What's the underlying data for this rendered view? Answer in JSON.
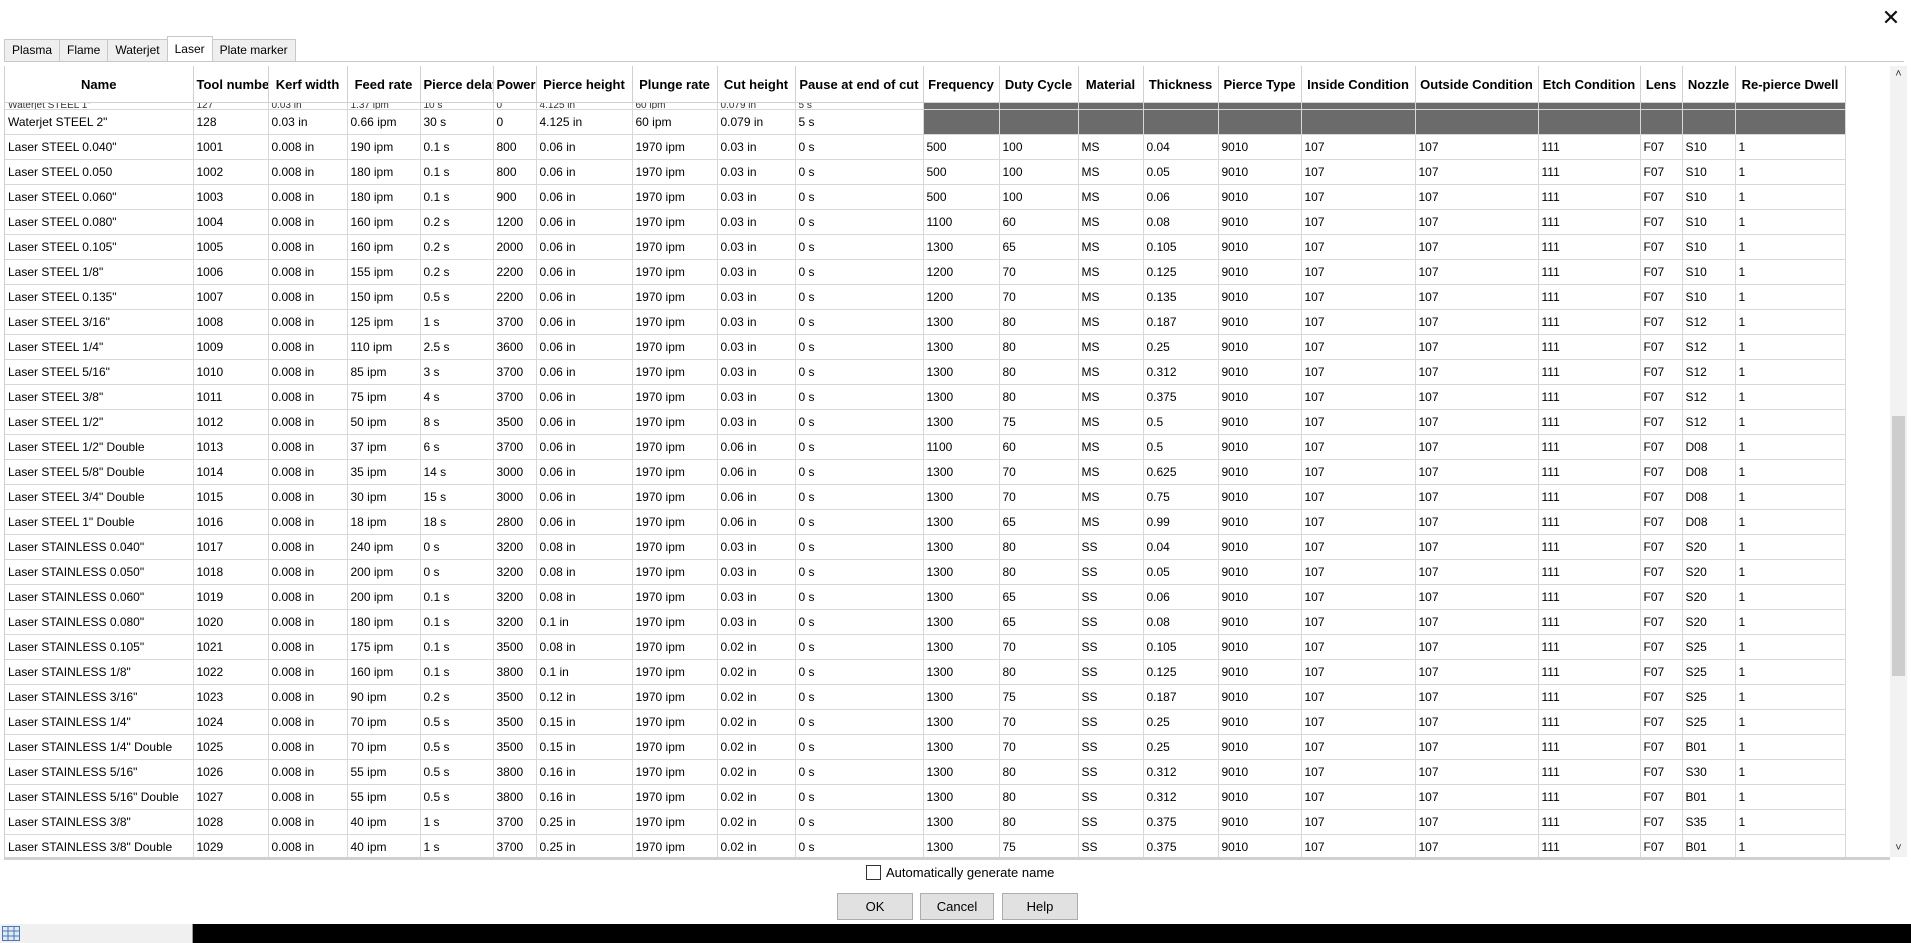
{
  "tabs": [
    "Plasma",
    "Flame",
    "Waterjet",
    "Laser",
    "Plate marker"
  ],
  "active_tab": "Laser",
  "columns": [
    "Name",
    "Tool number",
    "Kerf width",
    "Feed rate",
    "Pierce delay",
    "Power",
    "Pierce height",
    "Plunge rate",
    "Cut height",
    "Pause at end of cut",
    "Frequency",
    "Duty Cycle",
    "Material",
    "Thickness",
    "Pierce Type",
    "Inside Condition",
    "Outside Condition",
    "Etch Condition",
    "Lens",
    "Nozzle",
    "Re-pierce Dwell"
  ],
  "partial_top_row": [
    "Waterjet STEEL 1\"",
    "127",
    "0.03 in",
    "1.37 ipm",
    "10 s",
    "0",
    "4.125 in",
    "60 ipm",
    "0.079 in",
    "5 s",
    "",
    "",
    "",
    "",
    "",
    "",
    "",
    "",
    "",
    "",
    ""
  ],
  "rows": [
    [
      "Waterjet STEEL 2\"",
      "128",
      "0.03 in",
      "0.66 ipm",
      "30 s",
      "0",
      "4.125 in",
      "60 ipm",
      "0.079 in",
      "5 s",
      "",
      "",
      "",
      "",
      "",
      "",
      "",
      "",
      "",
      "",
      ""
    ],
    [
      "Laser STEEL 0.040\"",
      "1001",
      "0.008 in",
      "190 ipm",
      "0.1 s",
      "800",
      "0.06 in",
      "1970 ipm",
      "0.03 in",
      "0 s",
      "500",
      "100",
      "MS",
      "0.04",
      "9010",
      "107",
      "107",
      "111",
      "F07",
      "S10",
      "1"
    ],
    [
      "Laser STEEL 0.050",
      "1002",
      "0.008 in",
      "180 ipm",
      "0.1 s",
      "800",
      "0.06 in",
      "1970 ipm",
      "0.03 in",
      "0 s",
      "500",
      "100",
      "MS",
      "0.05",
      "9010",
      "107",
      "107",
      "111",
      "F07",
      "S10",
      "1"
    ],
    [
      "Laser STEEL 0.060\"",
      "1003",
      "0.008 in",
      "180 ipm",
      "0.1 s",
      "900",
      "0.06 in",
      "1970 ipm",
      "0.03 in",
      "0 s",
      "500",
      "100",
      "MS",
      "0.06",
      "9010",
      "107",
      "107",
      "111",
      "F07",
      "S10",
      "1"
    ],
    [
      "Laser STEEL 0.080\"",
      "1004",
      "0.008 in",
      "160 ipm",
      "0.2 s",
      "1200",
      "0.06 in",
      "1970 ipm",
      "0.03 in",
      "0 s",
      "1100",
      "60",
      "MS",
      "0.08",
      "9010",
      "107",
      "107",
      "111",
      "F07",
      "S10",
      "1"
    ],
    [
      "Laser STEEL 0.105\"",
      "1005",
      "0.008 in",
      "160 ipm",
      "0.2 s",
      "2000",
      "0.06 in",
      "1970 ipm",
      "0.03 in",
      "0 s",
      "1300",
      "65",
      "MS",
      "0.105",
      "9010",
      "107",
      "107",
      "111",
      "F07",
      "S10",
      "1"
    ],
    [
      "Laser STEEL 1/8\"",
      "1006",
      "0.008 in",
      "155 ipm",
      "0.2 s",
      "2200",
      "0.06 in",
      "1970 ipm",
      "0.03 in",
      "0 s",
      "1200",
      "70",
      "MS",
      "0.125",
      "9010",
      "107",
      "107",
      "111",
      "F07",
      "S10",
      "1"
    ],
    [
      "Laser STEEL 0.135\"",
      "1007",
      "0.008 in",
      "150 ipm",
      "0.5 s",
      "2200",
      "0.06 in",
      "1970 ipm",
      "0.03 in",
      "0 s",
      "1200",
      "70",
      "MS",
      "0.135",
      "9010",
      "107",
      "107",
      "111",
      "F07",
      "S10",
      "1"
    ],
    [
      "Laser STEEL 3/16\"",
      "1008",
      "0.008 in",
      "125 ipm",
      "1 s",
      "3700",
      "0.06 in",
      "1970 ipm",
      "0.03 in",
      "0 s",
      "1300",
      "80",
      "MS",
      "0.187",
      "9010",
      "107",
      "107",
      "111",
      "F07",
      "S12",
      "1"
    ],
    [
      "Laser STEEL 1/4\"",
      "1009",
      "0.008 in",
      "110 ipm",
      "2.5 s",
      "3600",
      "0.06 in",
      "1970 ipm",
      "0.03 in",
      "0 s",
      "1300",
      "80",
      "MS",
      "0.25",
      "9010",
      "107",
      "107",
      "111",
      "F07",
      "S12",
      "1"
    ],
    [
      "Laser STEEL 5/16\"",
      "1010",
      "0.008 in",
      "85 ipm",
      "3 s",
      "3700",
      "0.06 in",
      "1970 ipm",
      "0.03 in",
      "0 s",
      "1300",
      "80",
      "MS",
      "0.312",
      "9010",
      "107",
      "107",
      "111",
      "F07",
      "S12",
      "1"
    ],
    [
      "Laser STEEL 3/8\"",
      "1011",
      "0.008 in",
      "75 ipm",
      "4 s",
      "3700",
      "0.06 in",
      "1970 ipm",
      "0.03 in",
      "0 s",
      "1300",
      "80",
      "MS",
      "0.375",
      "9010",
      "107",
      "107",
      "111",
      "F07",
      "S12",
      "1"
    ],
    [
      "Laser STEEL 1/2\"",
      "1012",
      "0.008 in",
      "50 ipm",
      "8 s",
      "3500",
      "0.06 in",
      "1970 ipm",
      "0.03 in",
      "0 s",
      "1300",
      "75",
      "MS",
      "0.5",
      "9010",
      "107",
      "107",
      "111",
      "F07",
      "S12",
      "1"
    ],
    [
      "Laser STEEL 1/2\" Double",
      "1013",
      "0.008 in",
      "37 ipm",
      "6 s",
      "3700",
      "0.06 in",
      "1970 ipm",
      "0.06 in",
      "0 s",
      "1100",
      "60",
      "MS",
      "0.5",
      "9010",
      "107",
      "107",
      "111",
      "F07",
      "D08",
      "1"
    ],
    [
      "Laser STEEL 5/8\" Double",
      "1014",
      "0.008 in",
      "35 ipm",
      "14 s",
      "3000",
      "0.06 in",
      "1970 ipm",
      "0.06 in",
      "0 s",
      "1300",
      "70",
      "MS",
      "0.625",
      "9010",
      "107",
      "107",
      "111",
      "F07",
      "D08",
      "1"
    ],
    [
      "Laser STEEL 3/4\" Double",
      "1015",
      "0.008 in",
      "30 ipm",
      "15 s",
      "3000",
      "0.06 in",
      "1970 ipm",
      "0.06 in",
      "0 s",
      "1300",
      "70",
      "MS",
      "0.75",
      "9010",
      "107",
      "107",
      "111",
      "F07",
      "D08",
      "1"
    ],
    [
      "Laser STEEL 1\" Double",
      "1016",
      "0.008 in",
      "18 ipm",
      "18 s",
      "2800",
      "0.06 in",
      "1970 ipm",
      "0.06 in",
      "0 s",
      "1300",
      "65",
      "MS",
      "0.99",
      "9010",
      "107",
      "107",
      "111",
      "F07",
      "D08",
      "1"
    ],
    [
      "Laser STAINLESS 0.040\"",
      "1017",
      "0.008 in",
      "240 ipm",
      "0 s",
      "3200",
      "0.08 in",
      "1970 ipm",
      "0.03 in",
      "0 s",
      "1300",
      "80",
      "SS",
      "0.04",
      "9010",
      "107",
      "107",
      "111",
      "F07",
      "S20",
      "1"
    ],
    [
      "Laser STAINLESS 0.050\"",
      "1018",
      "0.008 in",
      "200 ipm",
      "0 s",
      "3200",
      "0.08 in",
      "1970 ipm",
      "0.03 in",
      "0 s",
      "1300",
      "80",
      "SS",
      "0.05",
      "9010",
      "107",
      "107",
      "111",
      "F07",
      "S20",
      "1"
    ],
    [
      "Laser STAINLESS 0.060\"",
      "1019",
      "0.008 in",
      "200 ipm",
      "0.1 s",
      "3200",
      "0.08 in",
      "1970 ipm",
      "0.03 in",
      "0 s",
      "1300",
      "65",
      "SS",
      "0.06",
      "9010",
      "107",
      "107",
      "111",
      "F07",
      "S20",
      "1"
    ],
    [
      "Laser STAINLESS 0.080\"",
      "1020",
      "0.008 in",
      "180 ipm",
      "0.1 s",
      "3200",
      "0.1 in",
      "1970 ipm",
      "0.03 in",
      "0 s",
      "1300",
      "65",
      "SS",
      "0.08",
      "9010",
      "107",
      "107",
      "111",
      "F07",
      "S20",
      "1"
    ],
    [
      "Laser STAINLESS 0.105\"",
      "1021",
      "0.008 in",
      "175 ipm",
      "0.1 s",
      "3500",
      "0.08 in",
      "1970 ipm",
      "0.02 in",
      "0 s",
      "1300",
      "70",
      "SS",
      "0.105",
      "9010",
      "107",
      "107",
      "111",
      "F07",
      "S25",
      "1"
    ],
    [
      "Laser STAINLESS 1/8\"",
      "1022",
      "0.008 in",
      "160 ipm",
      "0.1 s",
      "3800",
      "0.1 in",
      "1970 ipm",
      "0.02 in",
      "0 s",
      "1300",
      "80",
      "SS",
      "0.125",
      "9010",
      "107",
      "107",
      "111",
      "F07",
      "S25",
      "1"
    ],
    [
      "Laser STAINLESS 3/16\"",
      "1023",
      "0.008 in",
      "90 ipm",
      "0.2 s",
      "3500",
      "0.12 in",
      "1970 ipm",
      "0.02 in",
      "0 s",
      "1300",
      "75",
      "SS",
      "0.187",
      "9010",
      "107",
      "107",
      "111",
      "F07",
      "S25",
      "1"
    ],
    [
      "Laser STAINLESS 1/4\"",
      "1024",
      "0.008 in",
      "70 ipm",
      "0.5 s",
      "3500",
      "0.15 in",
      "1970 ipm",
      "0.02 in",
      "0 s",
      "1300",
      "70",
      "SS",
      "0.25",
      "9010",
      "107",
      "107",
      "111",
      "F07",
      "S25",
      "1"
    ],
    [
      "Laser STAINLESS 1/4\" Double",
      "1025",
      "0.008 in",
      "70 ipm",
      "0.5 s",
      "3500",
      "0.15 in",
      "1970 ipm",
      "0.02 in",
      "0 s",
      "1300",
      "70",
      "SS",
      "0.25",
      "9010",
      "107",
      "107",
      "111",
      "F07",
      "B01",
      "1"
    ],
    [
      "Laser STAINLESS 5/16\"",
      "1026",
      "0.008 in",
      "55 ipm",
      "0.5 s",
      "3800",
      "0.16 in",
      "1970 ipm",
      "0.02 in",
      "0 s",
      "1300",
      "80",
      "SS",
      "0.312",
      "9010",
      "107",
      "107",
      "111",
      "F07",
      "S30",
      "1"
    ],
    [
      "Laser STAINLESS 5/16\" Double",
      "1027",
      "0.008 in",
      "55 ipm",
      "0.5 s",
      "3800",
      "0.16 in",
      "1970 ipm",
      "0.02 in",
      "0 s",
      "1300",
      "80",
      "SS",
      "0.312",
      "9010",
      "107",
      "107",
      "111",
      "F07",
      "B01",
      "1"
    ],
    [
      "Laser STAINLESS 3/8\"",
      "1028",
      "0.008 in",
      "40 ipm",
      "1 s",
      "3700",
      "0.25 in",
      "1970 ipm",
      "0.02 in",
      "0 s",
      "1300",
      "80",
      "SS",
      "0.375",
      "9010",
      "107",
      "107",
      "111",
      "F07",
      "S35",
      "1"
    ],
    [
      "Laser STAINLESS 3/8\" Double",
      "1029",
      "0.008 in",
      "40 ipm",
      "1 s",
      "3700",
      "0.25 in",
      "1970 ipm",
      "0.02 in",
      "0 s",
      "1300",
      "75",
      "SS",
      "0.375",
      "9010",
      "107",
      "107",
      "111",
      "F07",
      "B01",
      "1"
    ]
  ],
  "auto_generate_label": "Automatically generate name",
  "buttons": {
    "ok": "OK",
    "cancel": "Cancel",
    "help": "Help"
  },
  "icons": {
    "close": "close-icon",
    "scroll_up": "chevron-up-icon",
    "scroll_down": "chevron-down-icon",
    "grid": "table-grid-icon"
  },
  "colors": {
    "disabled_cell": "#6b6b6b",
    "grid_line": "#d8d8d8"
  }
}
